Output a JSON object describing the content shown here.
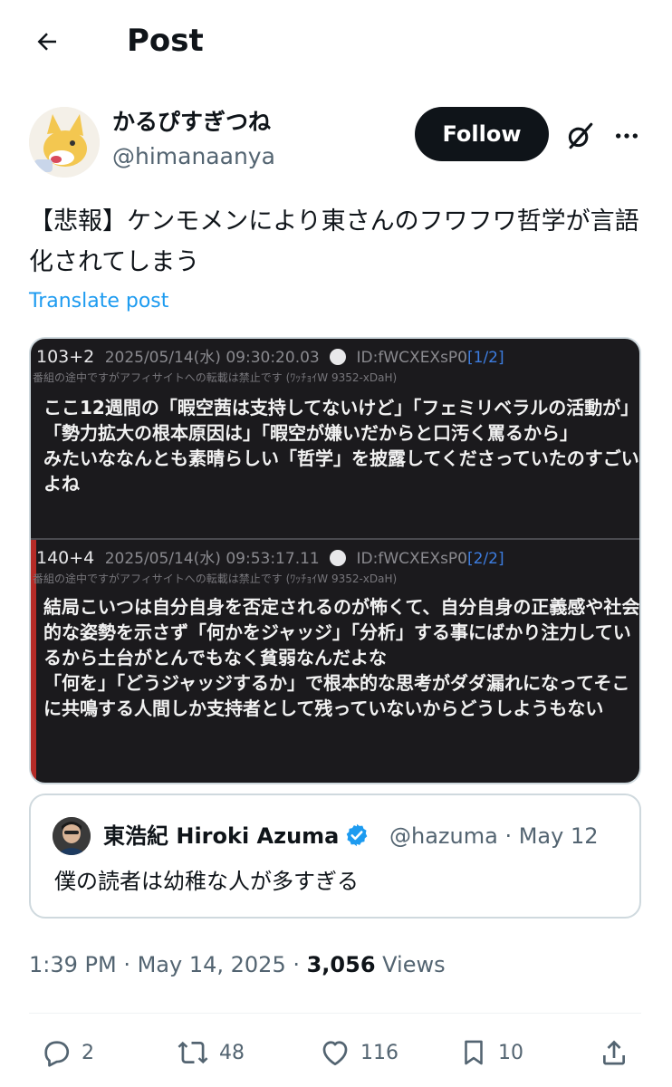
{
  "header": {
    "title": "Post"
  },
  "author": {
    "name": "かるぴすぎつね",
    "handle": "@himanaanya"
  },
  "follow_label": "Follow",
  "post": {
    "text": "【悲報】ケンモメンにより東さんのフワフワ哲学が言語化されてしまう",
    "translate_label": "Translate post"
  },
  "media": {
    "res1": {
      "num": "103+2",
      "date": "2025/05/14(水) 09:30:20.03",
      "id": "ID:fWCXEXsP0",
      "page": "[1/2]",
      "sub": "番組の途中ですがアフィサイトへの転載は禁止です (ﾜｯﾁｮｲW 9352-xDaH)",
      "body": "ここ12週間の「暇空茜は支持してないけど」「フェミリベラルの活動が」「勢力拡大の根本原因は」「暇空が嫌いだからと口汚く罵るから」\nみたいななんとも素晴らしい「哲学」を披露してくださっていたのすごいよね"
    },
    "res2": {
      "num": "140+4",
      "date": "2025/05/14(水) 09:53:17.11",
      "id": "ID:fWCXEXsP0",
      "page": "[2/2]",
      "sub": "番組の途中ですがアフィサイトへの転載は禁止です (ﾜｯﾁｮｲW 9352-xDaH)",
      "body": "結局こいつは自分自身を否定されるのが怖くて、自分自身の正義感や社会的な姿勢を示さず「何かをジャッジ」「分析」する事にばかり注力しているから土台がとんでもなく貧弱なんだよな\n「何を」「どうジャッジするか」で根本的な思考がダダ漏れになってそこに共鳴する人間しか支持者として残っていないからどうしようもない"
    }
  },
  "quote": {
    "name": "東浩紀 Hiroki Azuma",
    "handle": "@hazuma · May 12",
    "text": "僕の読者は幼稚な人が多すぎる"
  },
  "meta": {
    "time": "1:39 PM · May 14, 2025 · ",
    "views_count": "3,056",
    "views_label": " Views"
  },
  "actions": {
    "replies": "2",
    "reposts": "48",
    "likes": "116",
    "bookmarks": "10"
  },
  "icons": [
    "back-arrow-icon",
    "grok-icon",
    "more-icon",
    "verified-icon",
    "reply-icon",
    "repost-icon",
    "like-icon",
    "bookmark-icon",
    "share-icon"
  ],
  "colors": {
    "accent": "#1d9bf0",
    "text": "#0f1419",
    "muted": "#536471",
    "follow_bg": "#0f1419"
  }
}
